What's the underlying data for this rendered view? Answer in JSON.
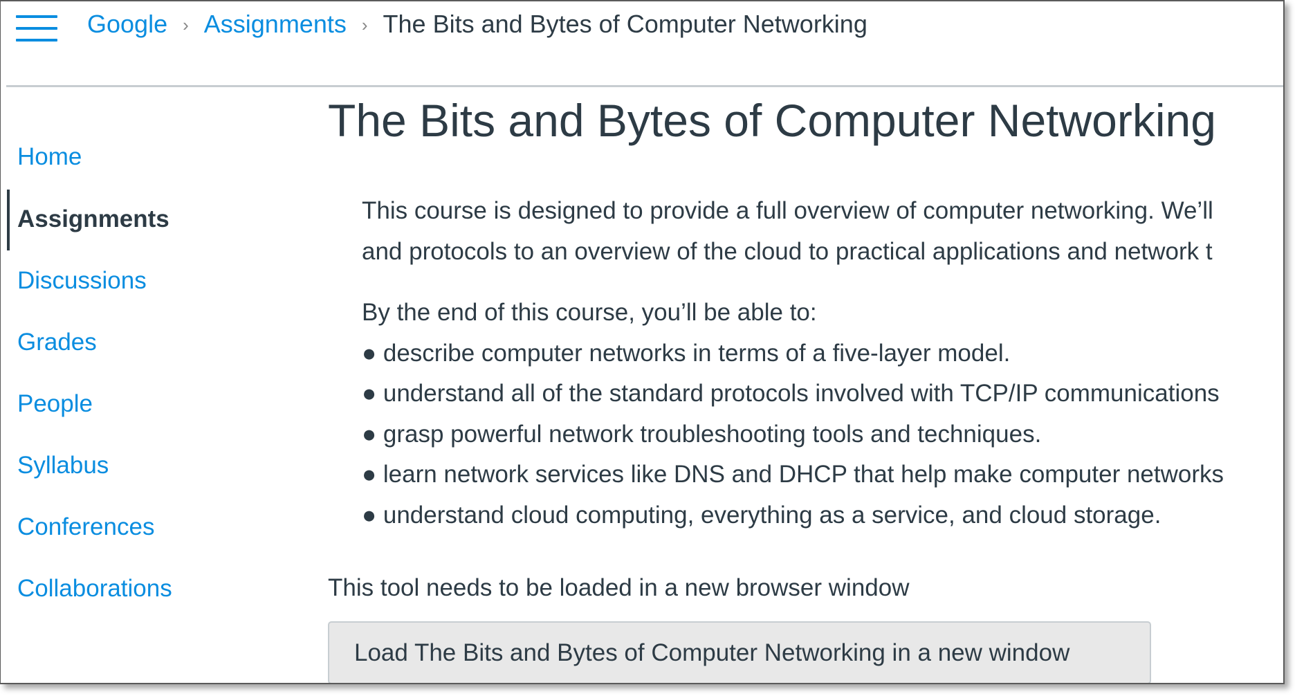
{
  "header": {
    "menu_icon": "hamburger-menu-icon",
    "breadcrumb": [
      {
        "label": "Google",
        "link": true
      },
      {
        "label": "Assignments",
        "link": true
      },
      {
        "label": "The Bits and Bytes of Computer Networking",
        "link": false
      }
    ],
    "separator_glyph": "›"
  },
  "sidebar": {
    "items": [
      {
        "label": "Home",
        "active": false
      },
      {
        "label": "Assignments",
        "active": true
      },
      {
        "label": "Discussions",
        "active": false
      },
      {
        "label": "Grades",
        "active": false
      },
      {
        "label": "People",
        "active": false
      },
      {
        "label": "Syllabus",
        "active": false
      },
      {
        "label": "Conferences",
        "active": false
      },
      {
        "label": "Collaborations",
        "active": false
      }
    ]
  },
  "main": {
    "title": "The Bits and Bytes of Computer Networking",
    "intro_lines": [
      "This course is designed to provide a full overview of computer networking. We’ll",
      "and protocols to an overview of the cloud to practical applications and network t"
    ],
    "outcomes_heading": "By the end of this course, you’ll be able to:",
    "outcomes": [
      "● describe computer networks in terms of a five-layer model.",
      "● understand all of the standard protocols involved with TCP/IP communications",
      "● grasp powerful network troubleshooting tools and techniques.",
      "● learn network services like DNS and DHCP that help make computer networks",
      "● understand cloud computing, everything as a service, and cloud storage."
    ],
    "tool_note": "This tool needs to be loaded in a new browser window",
    "load_button_label": "Load The Bits and Bytes of Computer Networking in a new window"
  },
  "colors": {
    "link": "#0a8de0",
    "text": "#2d3b45",
    "button_bg": "#e8e8e8",
    "divider": "#c7cdd1"
  }
}
